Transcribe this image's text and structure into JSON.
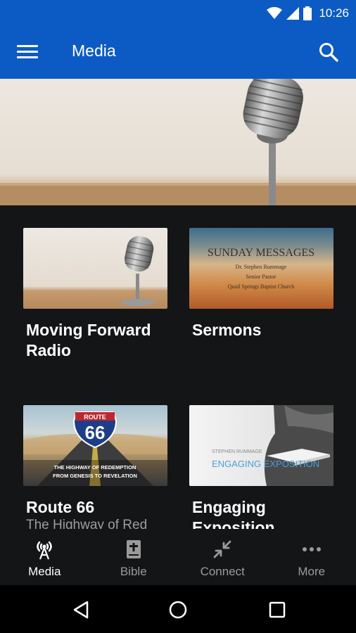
{
  "status_bar": {
    "time": "10:26"
  },
  "app_bar": {
    "title": "Media"
  },
  "hero": {
    "image": "vintage-microphone"
  },
  "cards": [
    {
      "title": "Moving Forward Radio",
      "subtitle": "",
      "image": "vintage-microphone"
    },
    {
      "title": "Sermons",
      "subtitle": "",
      "image": "sunday-messages-artwork",
      "art_text": {
        "heading": "SUNDAY MESSAGES",
        "line1": "Dr. Stephen Rummage",
        "line2": "Senior Pastor",
        "line3": "Quail Springs Baptist Church"
      }
    },
    {
      "title": "Route 66",
      "subtitle": "The Highway of Red",
      "image": "route-66-artwork",
      "art_text": {
        "sign_top": "ROUTE",
        "sign_num": "66",
        "line1": "THE HIGHWAY OF REDEMPTION",
        "line2": "FROM GENESIS TO REVELATION"
      }
    },
    {
      "title": "Engaging Exposition",
      "subtitle": "",
      "image": "engaging-exposition-artwork",
      "art_text": {
        "author": "STEPHEN RUMMAGE",
        "heading": "ENGAGING EXPOSITION"
      }
    }
  ],
  "bottom_nav": [
    {
      "label": "Media",
      "icon": "broadcast-icon",
      "active": true
    },
    {
      "label": "Bible",
      "icon": "bible-icon",
      "active": false
    },
    {
      "label": "Connect",
      "icon": "connect-icon",
      "active": false
    },
    {
      "label": "More",
      "icon": "more-icon",
      "active": false
    }
  ],
  "colors": {
    "primary": "#0c5bc4",
    "background": "#141517",
    "inactive": "#9a9a9a"
  }
}
